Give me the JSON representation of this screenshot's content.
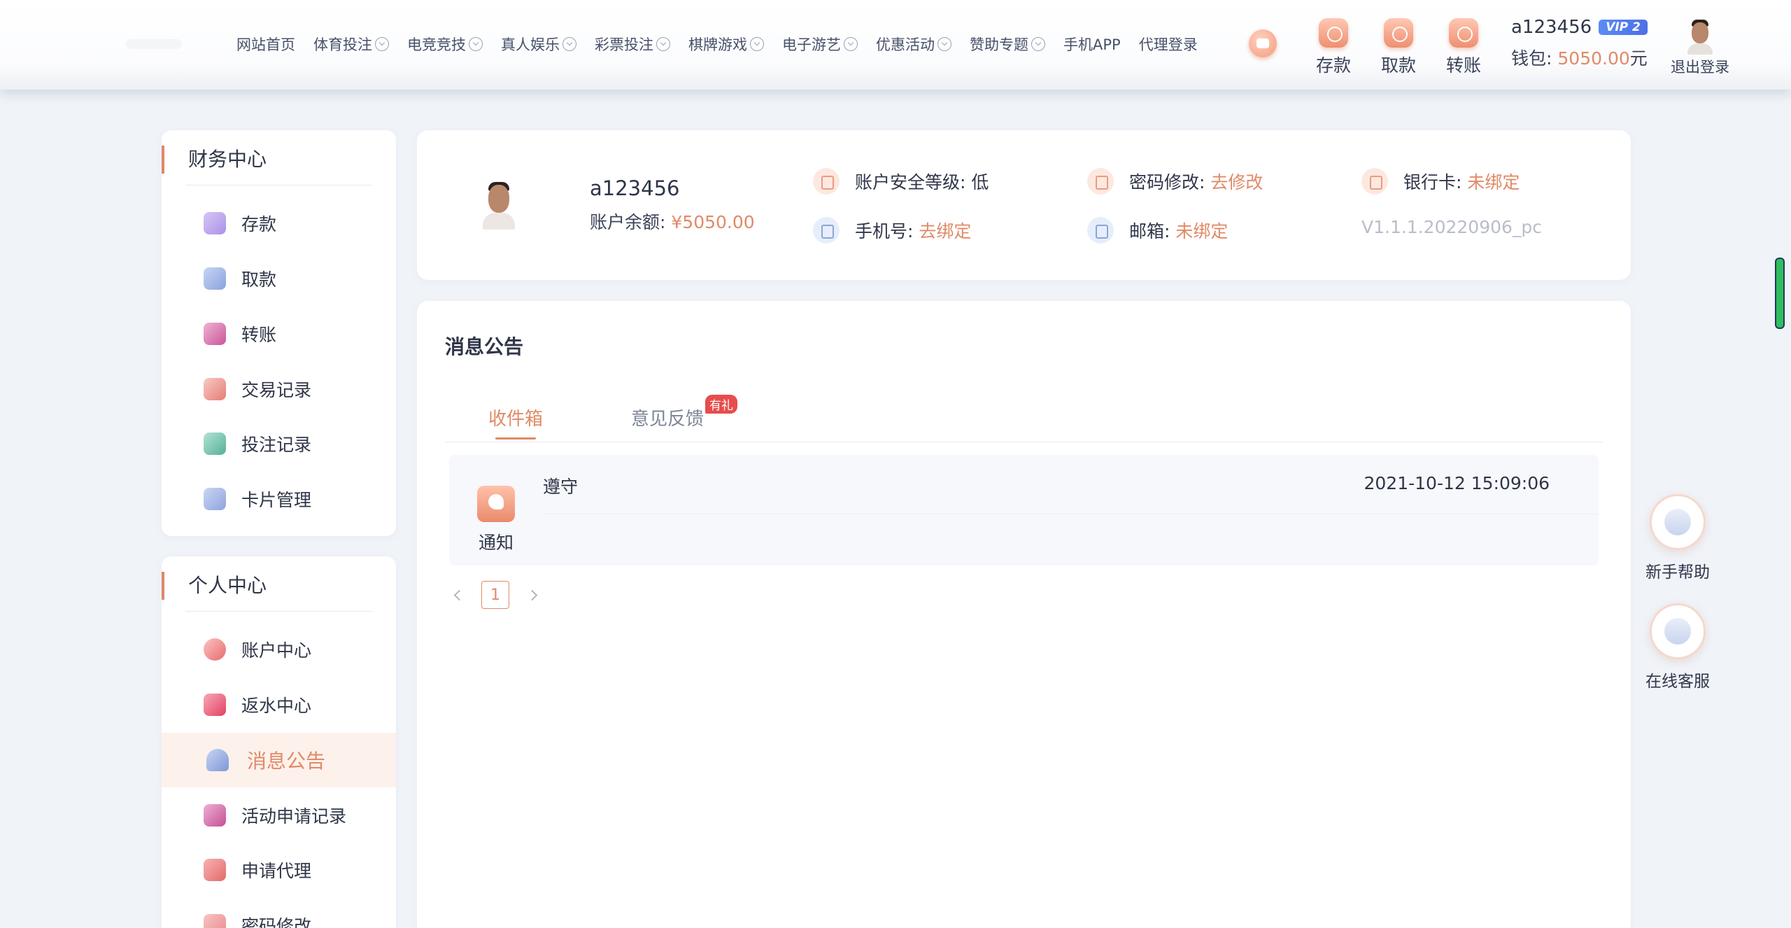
{
  "header": {
    "nav": [
      {
        "label": "网站首页",
        "dropdown": false
      },
      {
        "label": "体育投注",
        "dropdown": true
      },
      {
        "label": "电竞竞技",
        "dropdown": true
      },
      {
        "label": "真人娱乐",
        "dropdown": true
      },
      {
        "label": "彩票投注",
        "dropdown": true
      },
      {
        "label": "棋牌游戏",
        "dropdown": true
      },
      {
        "label": "电子游艺",
        "dropdown": true
      },
      {
        "label": "优惠活动",
        "dropdown": true
      },
      {
        "label": "赞助专题",
        "dropdown": true
      },
      {
        "label": "手机APP",
        "dropdown": false
      },
      {
        "label": "代理登录",
        "dropdown": false
      }
    ],
    "actions": {
      "deposit": "存款",
      "withdraw": "取款",
      "transfer": "转账"
    },
    "username": "a123456",
    "vip": "VIP 2",
    "wallet_label": "钱包:",
    "wallet_amount": "5050.00",
    "wallet_unit": "元",
    "logout": "退出登录"
  },
  "sidebar": {
    "finance_title": "财务中心",
    "finance_items": [
      {
        "label": "存款",
        "icon": "deposit-icon"
      },
      {
        "label": "取款",
        "icon": "withdraw-icon"
      },
      {
        "label": "转账",
        "icon": "transfer-icon"
      },
      {
        "label": "交易记录",
        "icon": "transaction-record-icon"
      },
      {
        "label": "投注记录",
        "icon": "bet-record-icon"
      },
      {
        "label": "卡片管理",
        "icon": "card-icon"
      }
    ],
    "personal_title": "个人中心",
    "personal_items": [
      {
        "label": "账户中心",
        "icon": "account-icon"
      },
      {
        "label": "返水中心",
        "icon": "rebate-icon"
      },
      {
        "label": "消息公告",
        "icon": "bell-icon",
        "active": true
      },
      {
        "label": "活动申请记录",
        "icon": "activity-icon"
      },
      {
        "label": "申请代理",
        "icon": "agent-icon"
      },
      {
        "label": "密码修改",
        "icon": "lock-icon"
      }
    ]
  },
  "account": {
    "username": "a123456",
    "balance_label": "账户余额:",
    "balance": "¥5050.00",
    "security_label": "账户安全等级:",
    "security_level": "低",
    "password_label": "密码修改:",
    "password_action": "去修改",
    "bank_label": "银行卡:",
    "bank_status": "未绑定",
    "phone_label": "手机号:",
    "phone_action": "去绑定",
    "email_label": "邮箱:",
    "email_status": "未绑定",
    "version": "V1.1.1.20220906_pc"
  },
  "messages": {
    "title": "消息公告",
    "tabs": [
      {
        "label": "收件箱",
        "active": true
      },
      {
        "label": "意见反馈",
        "badge": "有礼"
      }
    ],
    "items": [
      {
        "type": "通知",
        "title": "遵守",
        "time": "2021-10-12 15:09:06"
      }
    ],
    "pagination": {
      "current": "1"
    }
  },
  "float": {
    "help": "新手帮助",
    "service": "在线客服"
  },
  "colors": {
    "accent": "#e08a66",
    "vip": "#4d6fe6",
    "badge": "#e74d4d"
  }
}
